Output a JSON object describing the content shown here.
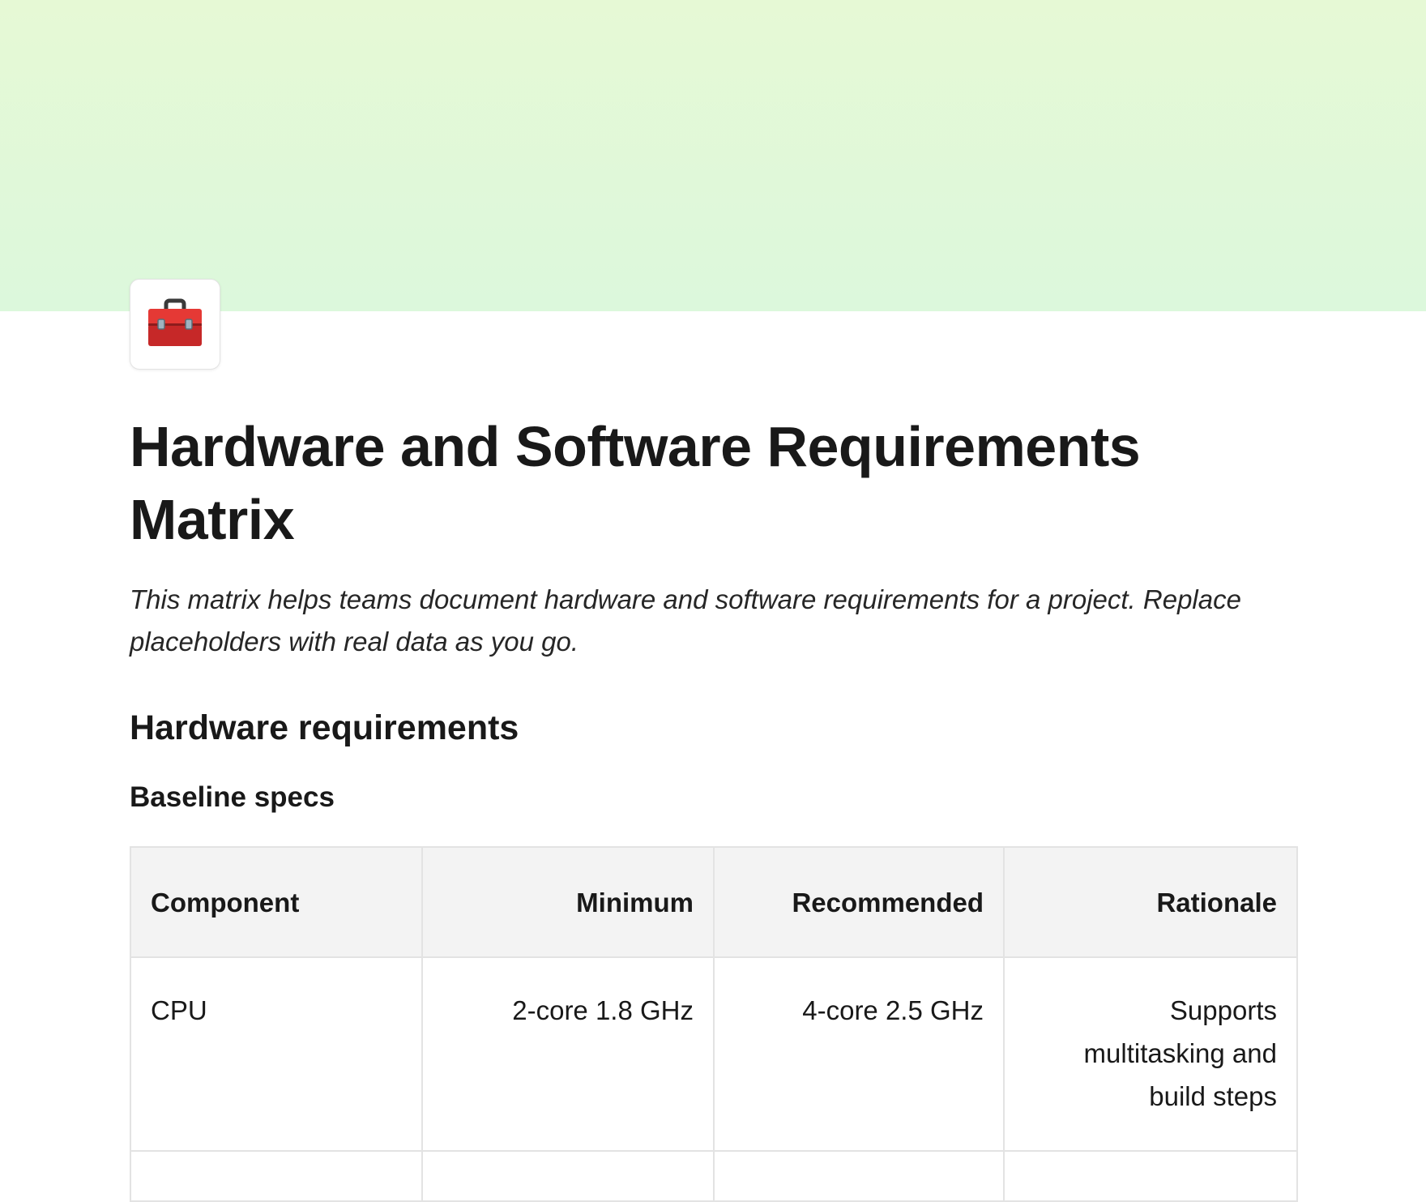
{
  "page": {
    "icon": "toolbox-icon",
    "title": "Hardware and Software Requirements Matrix",
    "description": "This matrix helps teams document hardware and software requirements for a project. Replace placeholders with real data as you go."
  },
  "sections": {
    "hardware_heading": "Hardware requirements",
    "baseline_heading": "Baseline specs"
  },
  "table": {
    "headers": [
      "Component",
      "Minimum",
      "Recommended",
      "Rationale"
    ],
    "rows": [
      [
        "CPU",
        "2-core 1.8 GHz",
        "4-core 2.5 GHz",
        "Supports multitasking and build steps"
      ]
    ]
  },
  "colors": {
    "cover_top": "#e6f9d5",
    "cover_bottom": "#dcf8dc",
    "header_bg": "#f3f3f3",
    "border": "#e3e3e3",
    "toolbox_red": "#d32f2f"
  }
}
